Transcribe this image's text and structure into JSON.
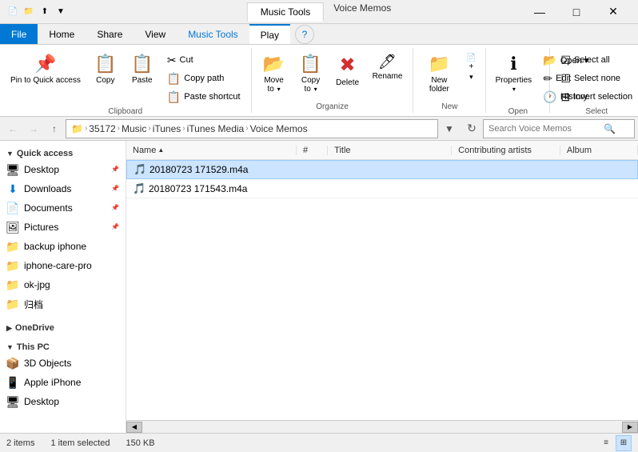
{
  "titlebar": {
    "icons": [
      "📄",
      "📁",
      "⬆"
    ],
    "app_tab": "Music Tools",
    "window_title": "Voice Memos",
    "controls": [
      "—",
      "□",
      "✕"
    ]
  },
  "ribbon_tabs": {
    "file": "File",
    "home": "Home",
    "share": "Share",
    "view": "View",
    "music_tools": "Music Tools",
    "play": "Play"
  },
  "ribbon": {
    "clipboard": {
      "label": "Clipboard",
      "pin_label": "Pin to Quick\naccess",
      "copy_label": "Copy",
      "paste_label": "Paste",
      "cut_label": "Cut",
      "copy_path_label": "Copy path",
      "paste_shortcut_label": "Paste shortcut"
    },
    "organize": {
      "label": "Organize",
      "move_label": "Move\nto",
      "copy_label": "Copy\nto",
      "delete_label": "Delete",
      "rename_label": "Rename"
    },
    "new": {
      "label": "New",
      "new_folder_label": "New\nfolder",
      "options_label": "..."
    },
    "open": {
      "label": "Open",
      "properties_label": "Properties",
      "open_label": "Open ▾",
      "edit_label": "Edit",
      "history_label": "History"
    },
    "select": {
      "label": "Select",
      "select_all_label": "Select all",
      "select_none_label": "Select none",
      "invert_label": "Invert selection"
    }
  },
  "addressbar": {
    "back_tooltip": "Back",
    "forward_tooltip": "Forward",
    "up_tooltip": "Up",
    "path": [
      "35172",
      "Music",
      "iTunes",
      "iTunes Media",
      "Voice Memos"
    ],
    "search_placeholder": "Search Voice Memos"
  },
  "sidebar": {
    "quick_access_label": "Quick access",
    "items": [
      {
        "label": "Desktop",
        "icon": "🖥",
        "pinned": true
      },
      {
        "label": "Downloads",
        "icon": "⬇",
        "pinned": true
      },
      {
        "label": "Documents",
        "icon": "📄",
        "pinned": true
      },
      {
        "label": "Pictures",
        "icon": "🖼",
        "pinned": true
      },
      {
        "label": "backup iphone",
        "icon": "📁",
        "pinned": false
      },
      {
        "label": "iphone-care-pro",
        "icon": "📁",
        "pinned": false
      },
      {
        "label": "ok-jpg",
        "icon": "📁",
        "pinned": false
      },
      {
        "label": "归档",
        "icon": "📁",
        "pinned": false
      }
    ],
    "onedrive_label": "OneDrive",
    "thispc_label": "This PC",
    "thispc_items": [
      {
        "label": "3D Objects",
        "icon": "📦"
      },
      {
        "label": "Apple iPhone",
        "icon": "📱"
      },
      {
        "label": "Desktop",
        "icon": "🖥"
      }
    ]
  },
  "filelist": {
    "columns": [
      {
        "label": "Name",
        "key": "name"
      },
      {
        "label": "#",
        "key": "hash"
      },
      {
        "label": "Title",
        "key": "title"
      },
      {
        "label": "Contributing artists",
        "key": "artists"
      },
      {
        "label": "Album",
        "key": "album"
      }
    ],
    "files": [
      {
        "name": "20180723 171529.m4a",
        "hash": "",
        "title": "",
        "artists": "",
        "album": "",
        "selected": true
      },
      {
        "name": "20180723 171543.m4a",
        "hash": "",
        "title": "",
        "artists": "",
        "album": "",
        "selected": false
      }
    ]
  },
  "statusbar": {
    "item_count": "2 items",
    "selection_info": "1 item selected",
    "size_info": "150 KB"
  }
}
